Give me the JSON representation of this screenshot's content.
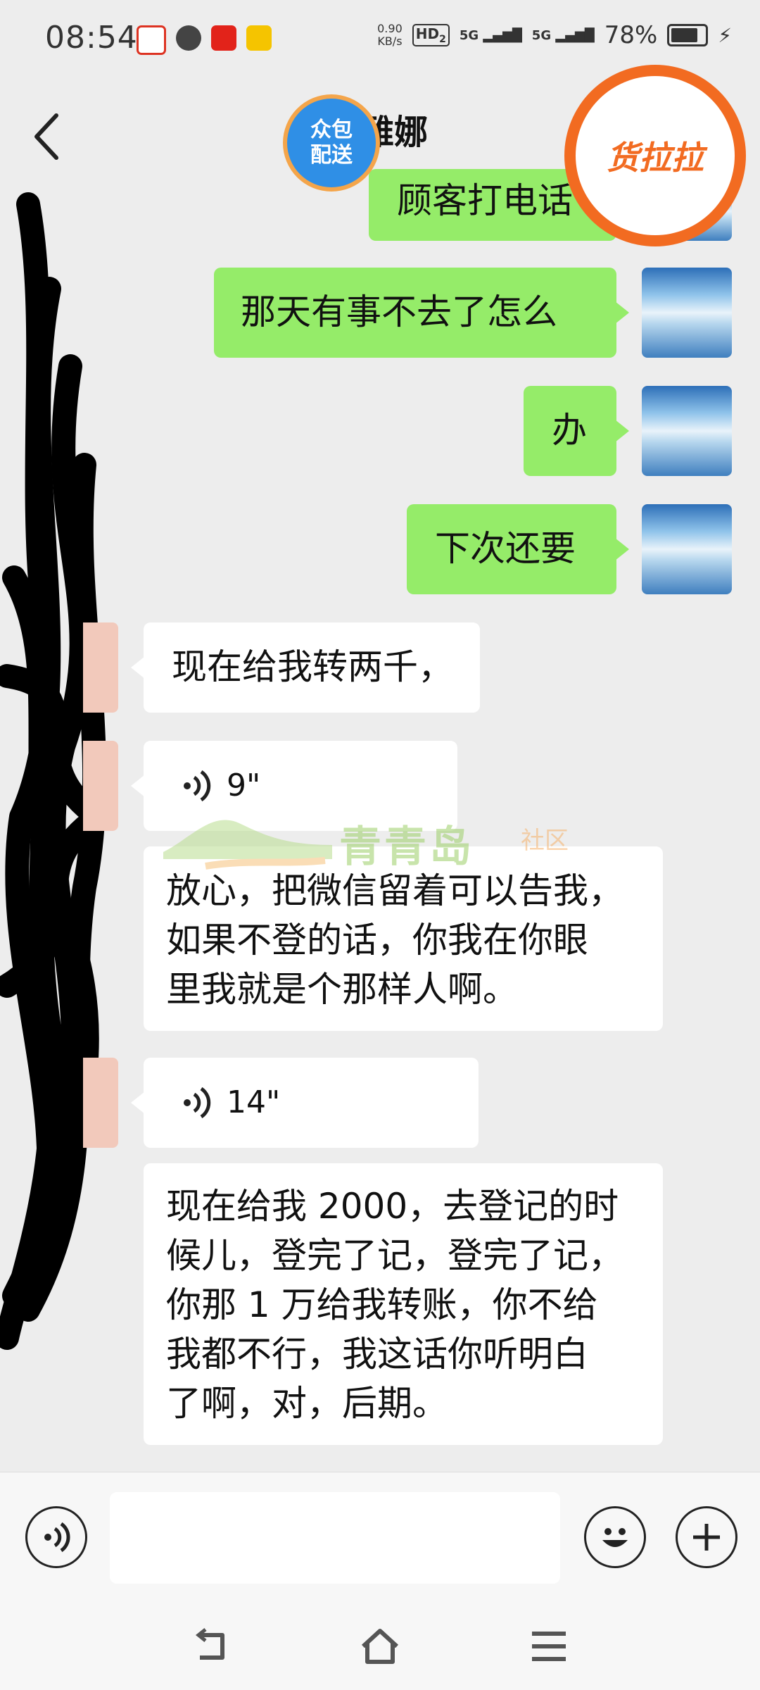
{
  "status_bar": {
    "time": "08:54",
    "net_speed_value": "0.90",
    "net_speed_unit": "KB/s",
    "hd_label": "HD",
    "hd_sub": "2",
    "sim1": "5G",
    "sim2": "5G",
    "battery_percent": "78%",
    "app_icons": [
      "app-red-c-icon",
      "chat-bubble-icon",
      "miaosong-icon",
      "yellow-app-icon"
    ]
  },
  "header": {
    "back_icon": "chevron-left-icon",
    "title_visible": "雅娜"
  },
  "floating": {
    "zhongbao_line1": "众包",
    "zhongbao_line2": "配送",
    "huolala": "货拉拉"
  },
  "messages": [
    {
      "side": "me",
      "text": "顾客打电话"
    },
    {
      "side": "me",
      "text": "那天有事不去了怎么"
    },
    {
      "side": "me",
      "text": "办"
    },
    {
      "side": "me",
      "text": "下次还要"
    },
    {
      "side": "them",
      "text": "现在给我转两千，"
    },
    {
      "side": "them",
      "type": "voice",
      "duration": "9\""
    },
    {
      "side": "them",
      "text_lines": [
        "放心，把微信留着可以告我，",
        "如果不登的话，你我在你眼",
        "里我就是个那样人啊。"
      ]
    },
    {
      "side": "them",
      "type": "voice",
      "duration": "14\""
    },
    {
      "side": "them",
      "text_lines": [
        "现在给我 2000，去登记的时",
        "候儿，登完了记，登完了记，",
        "你那 1 万给我转账，你不给",
        "我都不行，我这话你听明白",
        "了啊，对，后期。"
      ]
    }
  ],
  "watermark": {
    "text": "青青岛",
    "sub": "社区"
  },
  "input_bar": {
    "voice_button_icon": "voice-mode-icon",
    "text_value": "",
    "emoji_icon": "smiley-icon",
    "plus_icon": "plus-icon"
  },
  "nav_bar": {
    "icons": [
      "back-nav-icon",
      "home-nav-icon",
      "menu-nav-icon"
    ]
  },
  "colors": {
    "background": "#ededed",
    "my_bubble": "#95ec69",
    "their_bubble": "#ffffff"
  }
}
